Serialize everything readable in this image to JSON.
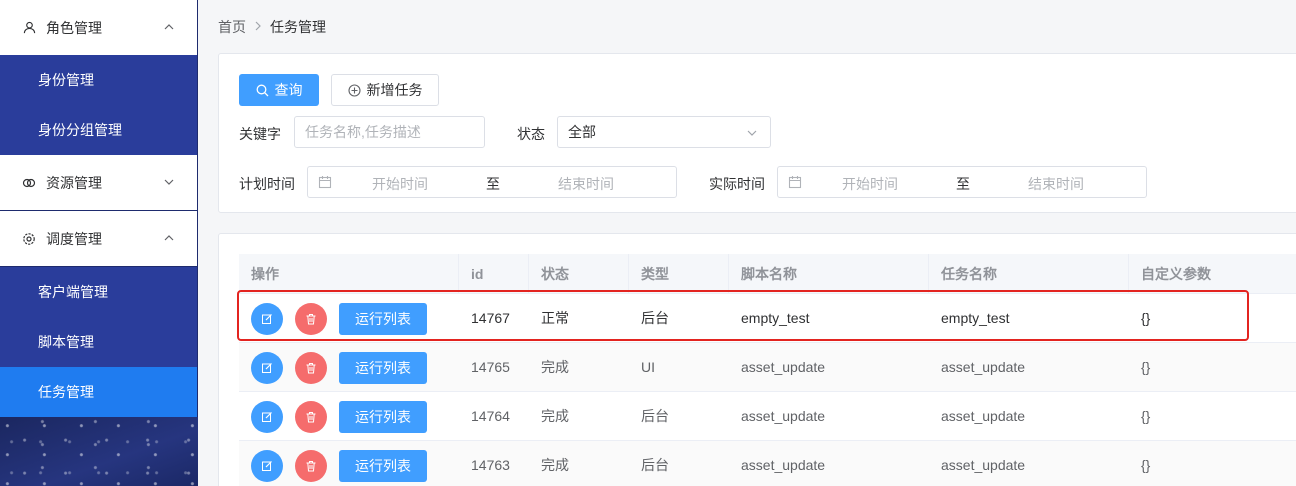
{
  "sidebar": {
    "groups": [
      {
        "label": "角色管理",
        "icon": "user-icon",
        "expanded": true
      },
      {
        "label": "资源管理",
        "icon": "resource-icon",
        "expanded": false
      },
      {
        "label": "调度管理",
        "icon": "gear-icon",
        "expanded": true
      }
    ],
    "items": [
      {
        "label": "身份管理"
      },
      {
        "label": "身份分组管理"
      },
      {
        "label": "客户端管理"
      },
      {
        "label": "脚本管理"
      },
      {
        "label": "任务管理",
        "active": true
      }
    ]
  },
  "breadcrumb": {
    "home": "首页",
    "current": "任务管理"
  },
  "filters": {
    "query_label": "查询",
    "add_label": "新增任务",
    "keyword_label": "关键字",
    "keyword_placeholder": "任务名称,任务描述",
    "status_label": "状态",
    "status_value": "全部",
    "plan_time_label": "计划时间",
    "actual_time_label": "实际时间",
    "start_placeholder": "开始时间",
    "end_placeholder": "结束时间",
    "range_sep": "至"
  },
  "table": {
    "columns": [
      "操作",
      "id",
      "状态",
      "类型",
      "脚本名称",
      "任务名称",
      "自定义参数"
    ],
    "run_label": "运行列表",
    "rows": [
      {
        "id": "14767",
        "status": "正常",
        "type": "后台",
        "script": "empty_test",
        "task": "empty_test",
        "params": "{}"
      },
      {
        "id": "14765",
        "status": "完成",
        "type": "UI",
        "script": "asset_update",
        "task": "asset_update",
        "params": "{}"
      },
      {
        "id": "14764",
        "status": "完成",
        "type": "后台",
        "script": "asset_update",
        "task": "asset_update",
        "params": "{}"
      },
      {
        "id": "14763",
        "status": "完成",
        "type": "后台",
        "script": "asset_update",
        "task": "asset_update",
        "params": "{}"
      }
    ]
  },
  "colors": {
    "primary": "#409eff",
    "danger": "#f56c6c",
    "sidebar": "#2a3d9b",
    "active": "#1f7cf0",
    "highlight": "#e32420"
  }
}
